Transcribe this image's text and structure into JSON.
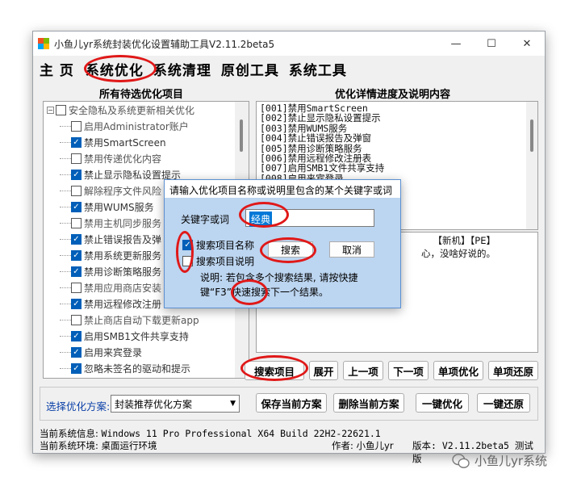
{
  "window": {
    "title": "小鱼儿yr系统封装优化设置辅助工具V2.11.2beta5"
  },
  "menu": [
    "主 页",
    "系统优化",
    "系统清理",
    "原创工具",
    "系统工具"
  ],
  "left_panel": {
    "header": "所有待选优化项目",
    "items": [
      {
        "label": "安全隐私及系统更新相关优化",
        "checked": false,
        "group": true
      },
      {
        "label": "启用Administrator账户",
        "checked": false
      },
      {
        "label": "禁用SmartScreen",
        "checked": true,
        "selected": true
      },
      {
        "label": "禁用传递优化内容",
        "checked": false
      },
      {
        "label": "禁止显示隐私设置提示",
        "checked": true
      },
      {
        "label": "解除程序文件风险",
        "checked": false
      },
      {
        "label": "禁用WUMS服务",
        "checked": true
      },
      {
        "label": "禁用主机同步服务",
        "checked": false
      },
      {
        "label": "禁止错误报告及弹",
        "checked": true
      },
      {
        "label": "禁用系统更新服务",
        "checked": true
      },
      {
        "label": "禁用诊断策略服务",
        "checked": true
      },
      {
        "label": "禁用应用商店安装",
        "checked": false
      },
      {
        "label": "禁用远程修改注册",
        "checked": true
      },
      {
        "label": "禁止商店自动下载更新app",
        "checked": false
      },
      {
        "label": "启用SMB1文件共享支持",
        "checked": true
      },
      {
        "label": "启用来宾登录",
        "checked": true
      },
      {
        "label": "忽略未签名的驱动和提示",
        "checked": true
      }
    ]
  },
  "right_panel": {
    "header": "优化详情进度及说明内容",
    "lines": [
      "[001]禁用SmartScreen",
      "[002]禁止显示隐私设置提示",
      "[003]禁用WUMS服务",
      "[004]禁止错误报告及弹窗",
      "[005]禁用诊断策略服务",
      "[006]禁用远程修改注册表",
      "[007]启用SMB1文件共享支持",
      "[008]启用来宾登录"
    ],
    "desc_line1": "【新机】【PE】",
    "desc_line2": "心，没啥好说的。"
  },
  "action_buttons": [
    "搜索项目",
    "展开",
    "上一项",
    "下一项",
    "单项优化",
    "单项还原"
  ],
  "scheme": {
    "label": "选择优化方案:",
    "selected": "封装推荐优化方案",
    "buttons": [
      "保存当前方案",
      "删除当前方案",
      "一键优化",
      "一键还原"
    ]
  },
  "status": {
    "system_info_label": "当前系统信息:",
    "system_info": "Windows 11 Pro Professional X64 Build 22H2-22621.1",
    "env_label": "当前系统环境:",
    "env": "桌面运行环境",
    "author": "作者: 小鱼儿yr",
    "version": "版本: V2.11.2beta5 测试版"
  },
  "dialog": {
    "title": "请输入优化项目名称或说明里包含的某个关键字或词",
    "keyword_label": "关键字或词",
    "keyword_value": "经典",
    "check_name": "搜索项目名称",
    "check_name_on": true,
    "check_desc": "搜索项目说明",
    "check_desc_on": false,
    "search_button": "搜索",
    "cancel_button": "取消",
    "note": "说明: 若包含多个搜索结果, 请按快捷键“F3”快速搜索下一个结果。"
  },
  "watermark": "小鱼儿yr系统",
  "colors": {
    "accent": "#005fb8",
    "highlight": "#e01818",
    "dialog_bg": "#bcd5f0"
  }
}
